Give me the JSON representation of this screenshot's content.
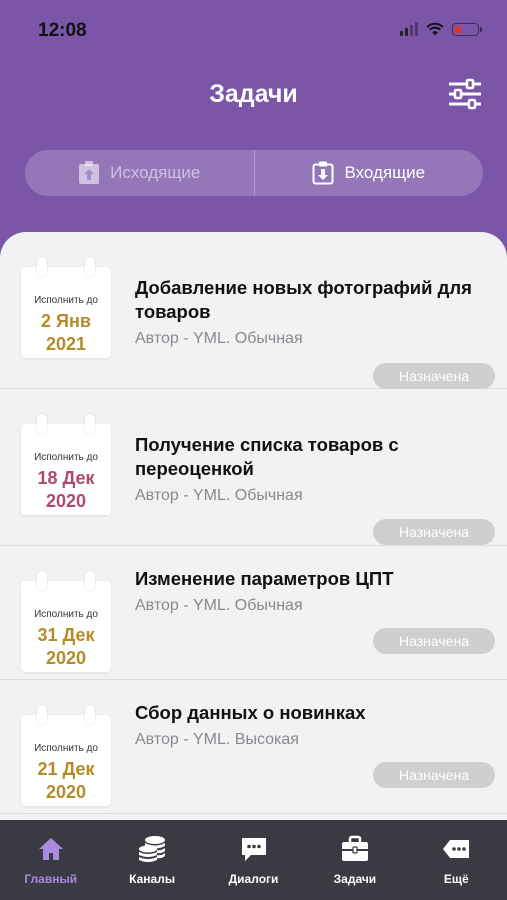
{
  "status_bar": {
    "time": "12:08"
  },
  "header": {
    "title": "Задачи"
  },
  "segments": {
    "outgoing": "Исходящие",
    "incoming": "Входящие"
  },
  "tasks": [
    {
      "due_label": "Исполнить до",
      "due_date": "2 Янв",
      "due_year": "2021",
      "due_color": "#b58a2a",
      "title": "Добавление новых фотографий для товаров",
      "meta": "Автор - YML. Обычная",
      "status": "Назначена"
    },
    {
      "due_label": "Исполнить до",
      "due_date": "18 Дек",
      "due_year": "2020",
      "due_color": "#b04a6a",
      "title": "Получение списка товаров с переоценкой",
      "meta": "Автор - YML. Обычная",
      "status": "Назначена"
    },
    {
      "due_label": "Исполнить до",
      "due_date": "31 Дек",
      "due_year": "2020",
      "due_color": "#b58a2a",
      "title": "Изменение параметров ЦПТ",
      "meta": "Автор - YML. Обычная",
      "status": "Назначена"
    },
    {
      "due_label": "Исполнить до",
      "due_date": "21 Дек",
      "due_year": "2020",
      "due_color": "#b58a2a",
      "title": "Сбор данных о новинках",
      "meta": "Автор - YML. Высокая",
      "status": "Назначена"
    }
  ],
  "tabbar": {
    "items": [
      {
        "label": "Главный",
        "icon": "home-icon"
      },
      {
        "label": "Каналы",
        "icon": "coins-icon"
      },
      {
        "label": "Диалоги",
        "icon": "chat-icon"
      },
      {
        "label": "Задачи",
        "icon": "briefcase-icon"
      },
      {
        "label": "Ещё",
        "icon": "more-icon"
      }
    ]
  },
  "colors": {
    "brand": "#7b56a8",
    "tab_active": "#a98be0",
    "tabbar_bg": "#3a3a42"
  }
}
